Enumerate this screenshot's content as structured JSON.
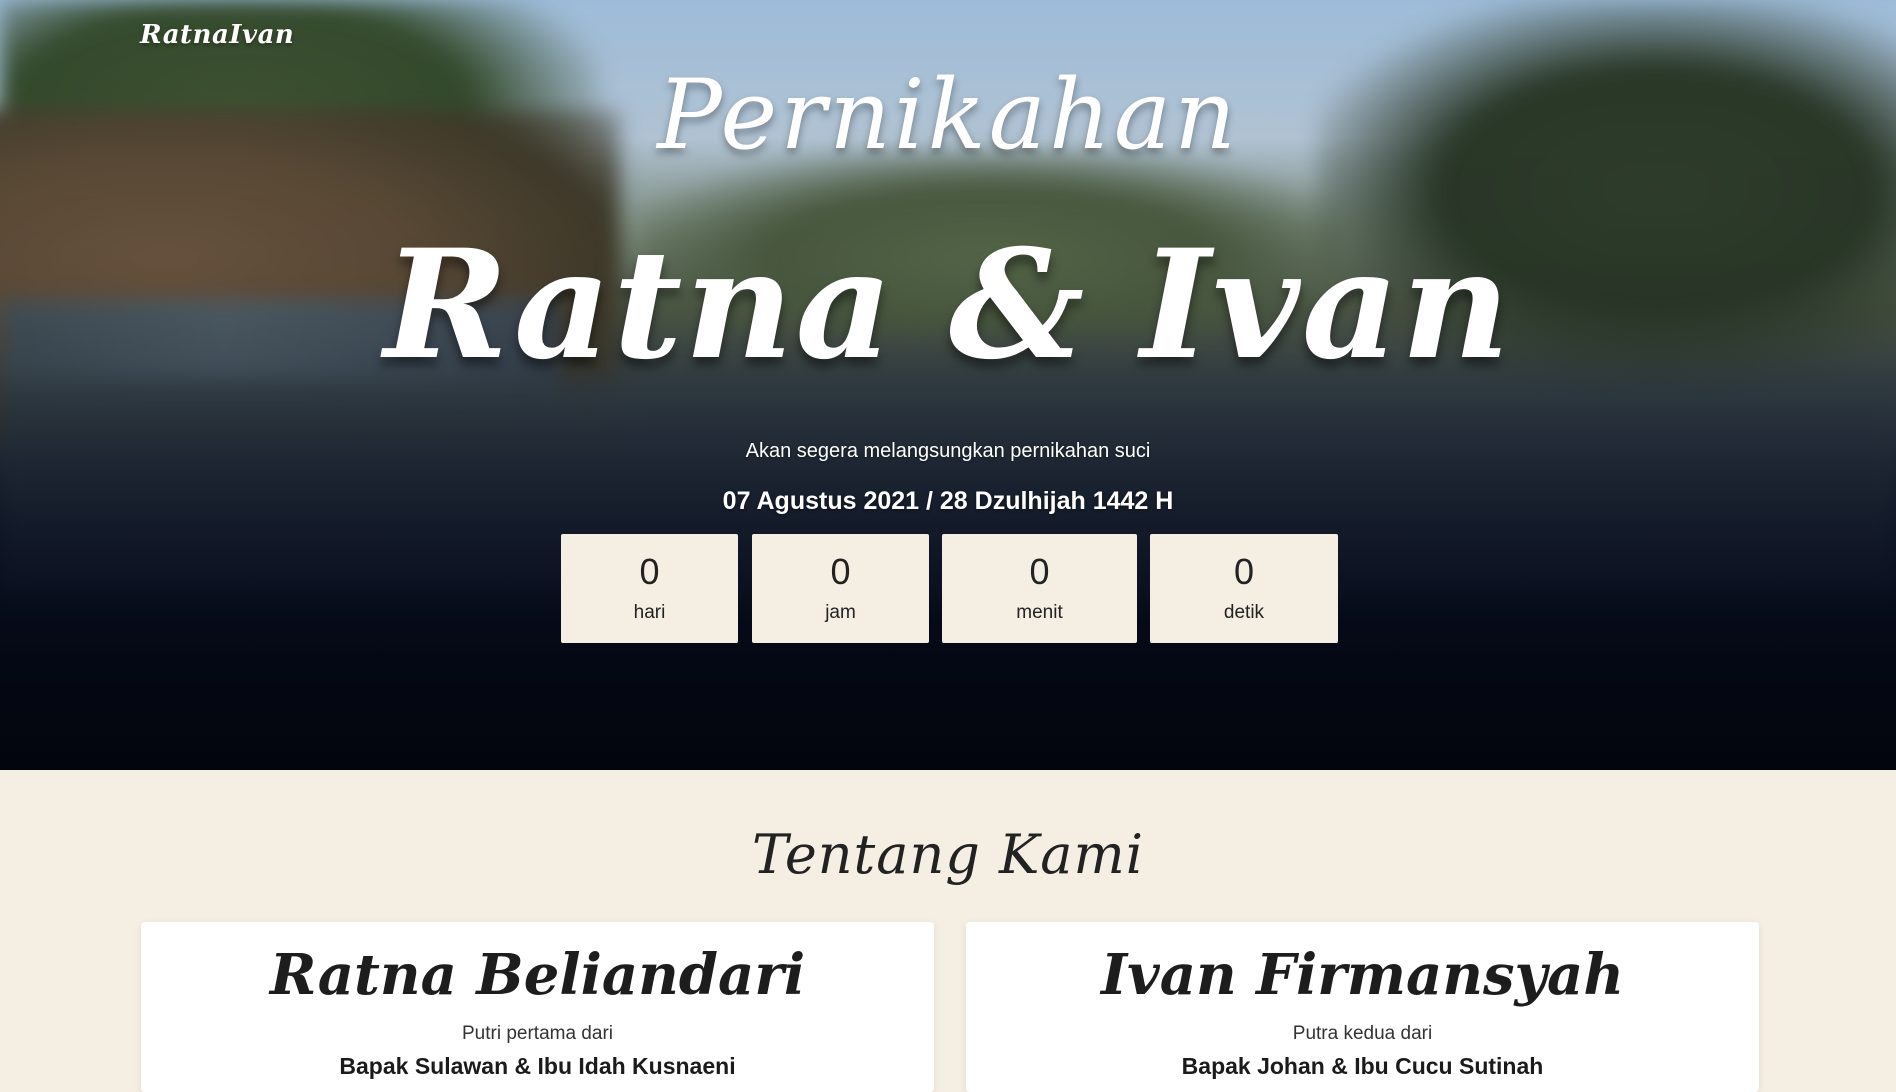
{
  "navbar": {
    "brand": "RatnaIvan"
  },
  "hero": {
    "subtitle": "Pernikahan",
    "title": "Ratna & Ivan",
    "tagline": "Akan segera melangsungkan pernikahan suci",
    "date": "07 Agustus 2021 / 28 Dzulhijah 1442 H"
  },
  "countdown": [
    {
      "value": "0",
      "label": "hari"
    },
    {
      "value": "0",
      "label": "jam"
    },
    {
      "value": "0",
      "label": "menit"
    },
    {
      "value": "0",
      "label": "detik"
    }
  ],
  "about": {
    "heading": "Tentang Kami",
    "bride": {
      "name": "Ratna Beliandari",
      "relation": "Putri pertama dari",
      "parents": "Bapak Sulawan & Ibu Idah Kusnaeni"
    },
    "groom": {
      "name": "Ivan Firmansyah",
      "relation": "Putra kedua dari",
      "parents": "Bapak Johan & Ibu Cucu Sutinah"
    }
  },
  "colors": {
    "cream": "#f5eee3",
    "text_dark": "#222222",
    "white": "#ffffff"
  }
}
